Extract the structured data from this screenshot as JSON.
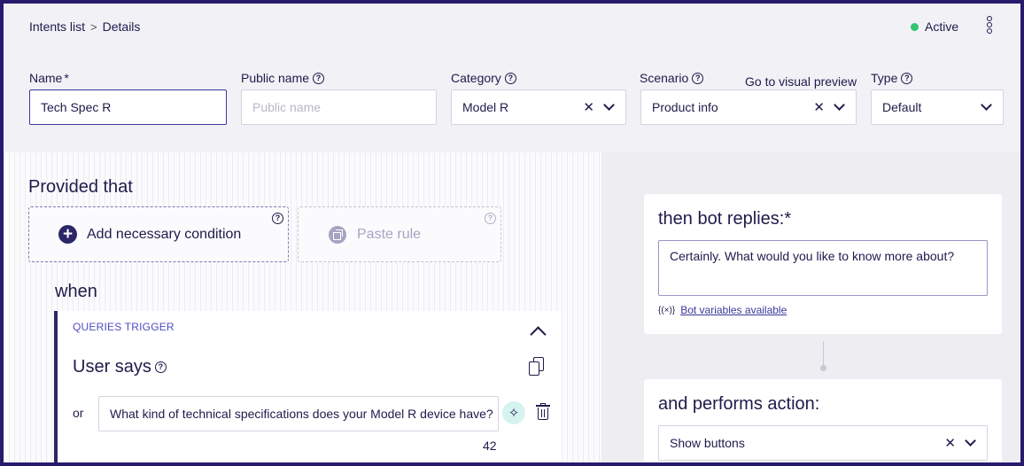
{
  "breadcrumb": {
    "parent": "Intents list",
    "separator": ">",
    "current": "Details"
  },
  "status": {
    "label": "Active",
    "color": "#34c471"
  },
  "fields": {
    "name": {
      "label": "Name",
      "required_mark": "*",
      "value": "Tech Spec R"
    },
    "public_name": {
      "label": "Public name",
      "placeholder": "Public name"
    },
    "category": {
      "label": "Category",
      "value": "Model R"
    },
    "scenario": {
      "label": "Scenario",
      "value": "Product info",
      "link": "Go to visual preview"
    },
    "type": {
      "label": "Type",
      "value": "Default"
    }
  },
  "conditions": {
    "heading": "Provided that",
    "add_label": "Add necessary condition",
    "paste_label": "Paste rule"
  },
  "when": {
    "heading": "when",
    "trigger_tag": "QUERIES TRIGGER",
    "user_says": "User says",
    "or_label": "or",
    "query": "What kind of technical specifications does your Model R device have?",
    "char_count": "42"
  },
  "reply": {
    "title": "then bot replies:*",
    "text": "Certainly. What would you like to know more about?",
    "vars_icon": "{(×)}",
    "vars_link": "Bot variables available"
  },
  "action": {
    "title": "and performs action:",
    "value": "Show buttons"
  },
  "icons": {
    "help": "?",
    "clear": "✕",
    "ai": "✧"
  },
  "colors": {
    "accent": "#2a2667",
    "frame": "#2a1a6e",
    "link": "#3b3899",
    "tag": "#4f4cc4"
  }
}
